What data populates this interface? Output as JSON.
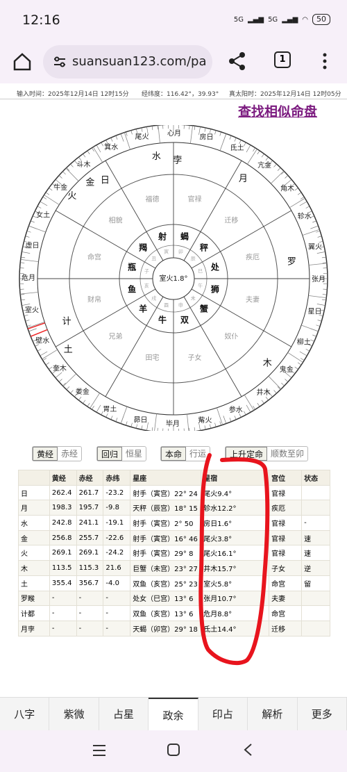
{
  "status": {
    "time": "12:16",
    "signal1": "5G",
    "signal2": "5G",
    "battery": "50"
  },
  "browser": {
    "url": "suansuan123.com/pa",
    "tabs": "1"
  },
  "info": {
    "input_time": "输入时间：2025年12月14日 12时15分",
    "coords": "经纬度：116.42°，39.93°",
    "solar_time": "真太阳时：2025年12月14日 12时05分"
  },
  "link_label": "查找相似命盘",
  "chart_data": {
    "type": "astrology-wheel",
    "center": "室火1.8°",
    "mansions": [
      "氐土",
      "亢金",
      "角木",
      "轸水",
      "翼火",
      "张月",
      "星日",
      "柳土",
      "鬼金",
      "井木",
      "参水",
      "觜火",
      "毕月",
      "昴日",
      "胃土",
      "娄金",
      "奎木",
      "壁水",
      "室火",
      "危月",
      "虚日",
      "女土",
      "牛金",
      "斗木",
      "箕水",
      "尾火",
      "心月",
      "房日"
    ],
    "palaces": [
      "官禄",
      "迁移",
      "疾厄",
      "夫妻",
      "奴仆",
      "子女",
      "田宅",
      "兄弟",
      "财帛",
      "命宫",
      "相貌",
      "福德"
    ],
    "signs": [
      "射",
      "蝎",
      "秤",
      "处",
      "狮",
      "蟹",
      "双",
      "牛",
      "羊",
      "鱼",
      "瓶",
      "羯"
    ],
    "branches": [
      "寅",
      "卯",
      "辰",
      "巳",
      "午",
      "未",
      "申",
      "酉",
      "戌",
      "亥",
      "子",
      "丑"
    ],
    "planets": [
      {
        "name": "日",
        "col": "#111"
      },
      {
        "name": "金",
        "col": "#111"
      },
      {
        "name": "水",
        "col": "#111"
      },
      {
        "name": "孛",
        "col": "#111"
      },
      {
        "name": "火",
        "col": "#111"
      },
      {
        "name": "月",
        "col": "#111"
      },
      {
        "name": "罗",
        "col": "#111"
      },
      {
        "name": "木",
        "col": "#111"
      },
      {
        "name": "计",
        "col": "#111"
      },
      {
        "name": "土",
        "col": "#111"
      }
    ]
  },
  "toggles": {
    "a1": "黄经",
    "a2": "赤经",
    "b1": "回归",
    "b2": "恒星",
    "c1": "本命",
    "c2": "行运",
    "d1": "上升定命",
    "d2": "顺数至卯"
  },
  "table": {
    "headers": [
      "",
      "黄经",
      "赤经",
      "赤纬",
      "星座",
      "星宿",
      "宫位",
      "状态"
    ],
    "rows": [
      [
        "日",
        "262.4",
        "261.7",
        "-23.2",
        "射手（寅宫）22° 24",
        "尾火9.4°",
        "官禄",
        ""
      ],
      [
        "月",
        "198.3",
        "195.7",
        "-9.8",
        "天秤（辰宫）18° 15",
        "轸水12.2°",
        "疾厄",
        ""
      ],
      [
        "水",
        "242.8",
        "241.1",
        "-19.1",
        "射手（寅宫）2° 50",
        "房日1.6°",
        "官禄",
        "-"
      ],
      [
        "金",
        "256.8",
        "255.7",
        "-22.6",
        "射手（寅宫）16° 46",
        "尾火3.8°",
        "官禄",
        "速"
      ],
      [
        "火",
        "269.1",
        "269.1",
        "-24.2",
        "射手（寅宫）29° 8",
        "尾火16.1°",
        "官禄",
        "速"
      ],
      [
        "木",
        "113.5",
        "115.3",
        "21.6",
        "巨蟹（未宫）23° 27",
        "井木15.7°",
        "子女",
        "逆"
      ],
      [
        "土",
        "355.4",
        "356.7",
        "-4.0",
        "双鱼（亥宫）25° 23",
        "室火5.8°",
        "命宫",
        "留"
      ],
      [
        "罗睺",
        "-",
        "-",
        "-",
        "处女（巳宫）13° 6",
        "张月10.7°",
        "夫妻",
        ""
      ],
      [
        "计都",
        "-",
        "-",
        "-",
        "双鱼（亥宫）13° 6",
        "危月8.8°",
        "命宫",
        ""
      ],
      [
        "月孛",
        "-",
        "-",
        "-",
        "天蝎（卯宫）29° 18",
        "氐土14.4°",
        "迁移",
        ""
      ]
    ]
  },
  "nav": [
    "八字",
    "紫微",
    "占星",
    "政余",
    "印占",
    "解析",
    "更多"
  ],
  "nav_active": "政余"
}
